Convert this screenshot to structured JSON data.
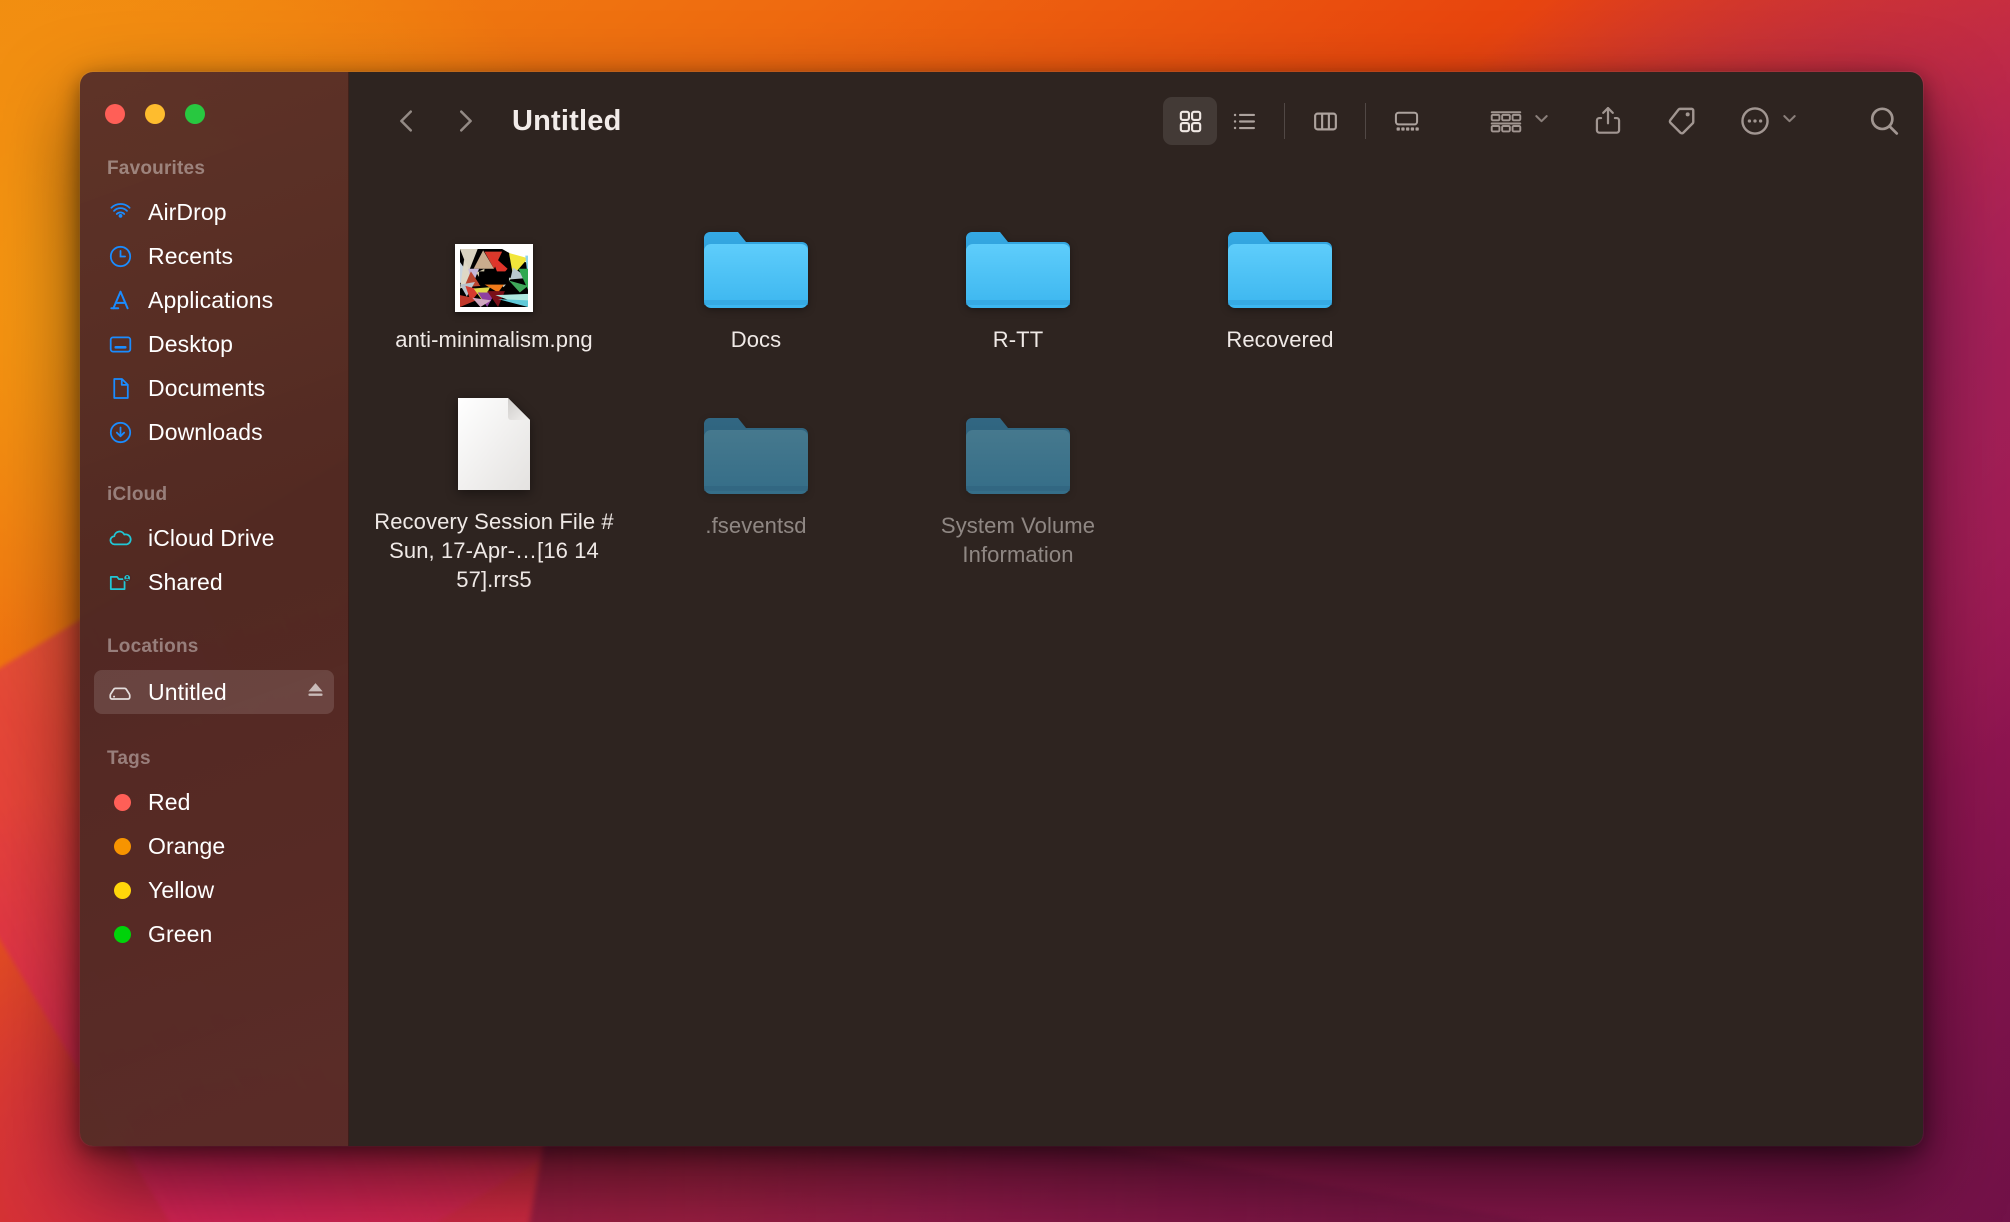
{
  "window": {
    "title": "Untitled",
    "traffic_lights": [
      {
        "name": "close",
        "color": "#ff5f57"
      },
      {
        "name": "minimize",
        "color": "#febc2e"
      },
      {
        "name": "zoom",
        "color": "#28c840"
      }
    ]
  },
  "sidebar": {
    "sections": [
      {
        "title": "Favourites",
        "items": [
          {
            "label": "AirDrop",
            "icon": "airdrop-icon",
            "selected": false
          },
          {
            "label": "Recents",
            "icon": "clock-icon",
            "selected": false
          },
          {
            "label": "Applications",
            "icon": "applications-icon",
            "selected": false
          },
          {
            "label": "Desktop",
            "icon": "desktop-icon",
            "selected": false
          },
          {
            "label": "Documents",
            "icon": "document-icon",
            "selected": false
          },
          {
            "label": "Downloads",
            "icon": "download-icon",
            "selected": false
          }
        ]
      },
      {
        "title": "iCloud",
        "items": [
          {
            "label": "iCloud Drive",
            "icon": "cloud-icon",
            "selected": false
          },
          {
            "label": "Shared",
            "icon": "shared-folder-icon",
            "selected": false
          }
        ]
      },
      {
        "title": "Locations",
        "items": [
          {
            "label": "Untitled",
            "icon": "external-drive-icon",
            "selected": true,
            "eject": true
          }
        ]
      },
      {
        "title": "Tags",
        "items": [
          {
            "label": "Red",
            "icon": "tag-dot-icon",
            "color": "#ff5f57",
            "selected": false
          },
          {
            "label": "Orange",
            "icon": "tag-dot-icon",
            "color": "#f79400",
            "selected": false
          },
          {
            "label": "Yellow",
            "icon": "tag-dot-icon",
            "color": "#ffd60a",
            "selected": false
          },
          {
            "label": "Green",
            "icon": "tag-dot-icon",
            "color": "#00d30a",
            "selected": false
          }
        ]
      }
    ]
  },
  "toolbar": {
    "back_icon": "chevron-left-icon",
    "forward_icon": "chevron-right-icon",
    "breadcrumb": "Untitled",
    "view_modes": [
      {
        "name": "icon-view",
        "icon": "grid-icon",
        "active": true
      },
      {
        "name": "list-view",
        "icon": "list-icon",
        "active": false
      },
      {
        "name": "column-view",
        "icon": "columns-icon",
        "active": false
      },
      {
        "name": "gallery-view",
        "icon": "gallery-icon",
        "active": false
      }
    ],
    "group_by_icon": "group-by-icon",
    "share_icon": "share-icon",
    "tag_icon": "tag-icon",
    "more_icon": "more-circle-icon",
    "search_icon": "search-icon",
    "chevron_icon": "chevron-down-icon"
  },
  "files": [
    {
      "name": "anti-minimalism.png",
      "type": "image",
      "hidden": false
    },
    {
      "name": "Docs",
      "type": "folder",
      "hidden": false
    },
    {
      "name": "R-TT",
      "type": "folder",
      "hidden": false
    },
    {
      "name": "Recovered",
      "type": "folder",
      "hidden": false
    },
    {
      "name": "Recovery Session File # Sun, 17-Apr-…[16 14 57].rrs5",
      "type": "document",
      "hidden": false
    },
    {
      "name": ".fseventsd",
      "type": "folder",
      "hidden": true
    },
    {
      "name": "System Volume Information",
      "type": "folder",
      "hidden": true
    }
  ],
  "colors": {
    "window_background": "#2e2420",
    "sidebar_background": "#4d2722",
    "folder_blue": "#4cc3f5",
    "accent_blue": "#1a8cff",
    "accent_teal": "#21c7d6",
    "text_primary": "#efe9e6"
  }
}
